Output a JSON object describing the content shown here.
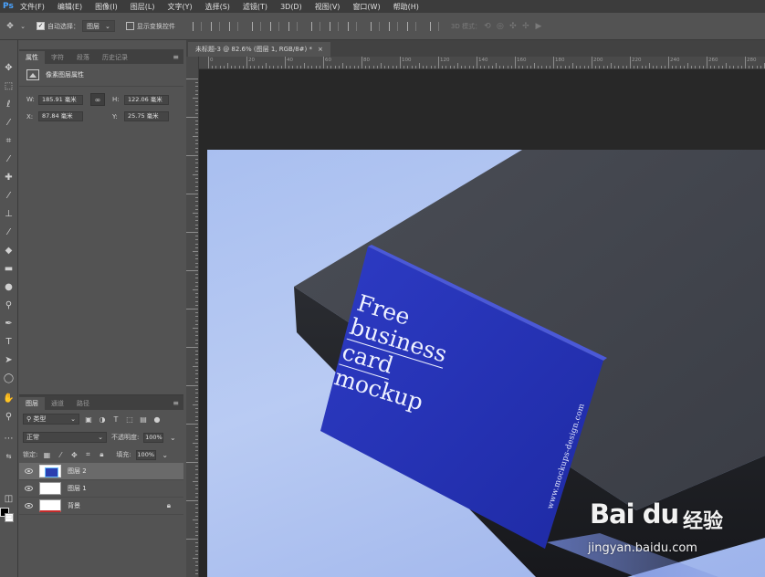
{
  "app": {
    "logo": "Ps"
  },
  "menu": [
    "文件(F)",
    "编辑(E)",
    "图像(I)",
    "图层(L)",
    "文字(Y)",
    "选择(S)",
    "滤镜(T)",
    "3D(D)",
    "视图(V)",
    "窗口(W)",
    "帮助(H)"
  ],
  "options": {
    "auto_select_label": "自动选择：",
    "auto_select_value": "图层",
    "show_transform_label": "显示变换控件",
    "mode_3d_label": "3D 模式："
  },
  "properties": {
    "tabs": [
      "属性",
      "字符",
      "段落",
      "历史记录"
    ],
    "active_tab": "属性",
    "header": "像素图层属性",
    "w_label": "W:",
    "w_value": "185.91 毫米",
    "h_label": "H:",
    "h_value": "122.06 毫米",
    "x_label": "X:",
    "x_value": "87.84 毫米",
    "y_label": "Y:",
    "y_value": "25.75 毫米"
  },
  "layers_panel": {
    "tabs": [
      "图层",
      "通道",
      "路径"
    ],
    "active_tab": "图层",
    "filter_kind": "类型",
    "blend_mode": "正常",
    "opacity_label": "不透明度:",
    "opacity_value": "100%",
    "lock_label": "锁定:",
    "fill_label": "填充:",
    "fill_value": "100%",
    "layers": [
      {
        "name": "图层 2",
        "selected": true,
        "locked": false
      },
      {
        "name": "图层 1",
        "selected": false,
        "locked": false
      },
      {
        "name": "背景",
        "selected": false,
        "locked": true
      }
    ]
  },
  "document": {
    "tab_title": "未标题-3 @ 82.6% (图层 1, RGB/8#) *",
    "close_glyph": "×",
    "ruler_numbers": [
      "0",
      "20",
      "40",
      "60",
      "80",
      "100",
      "120",
      "140",
      "160",
      "180",
      "200",
      "220",
      "240",
      "260",
      "280"
    ]
  },
  "canvas": {
    "card_lines": [
      "Free",
      "business",
      "card",
      "mockup"
    ],
    "card_url": "www.mockups-design.com",
    "colors": {
      "card": "#2633b6",
      "surface": "#a9bff0",
      "block": "#3b3e45"
    }
  },
  "watermark": {
    "brand": "Bai du",
    "brand_cn": "经验",
    "url": "jingyan.baidu.com"
  }
}
